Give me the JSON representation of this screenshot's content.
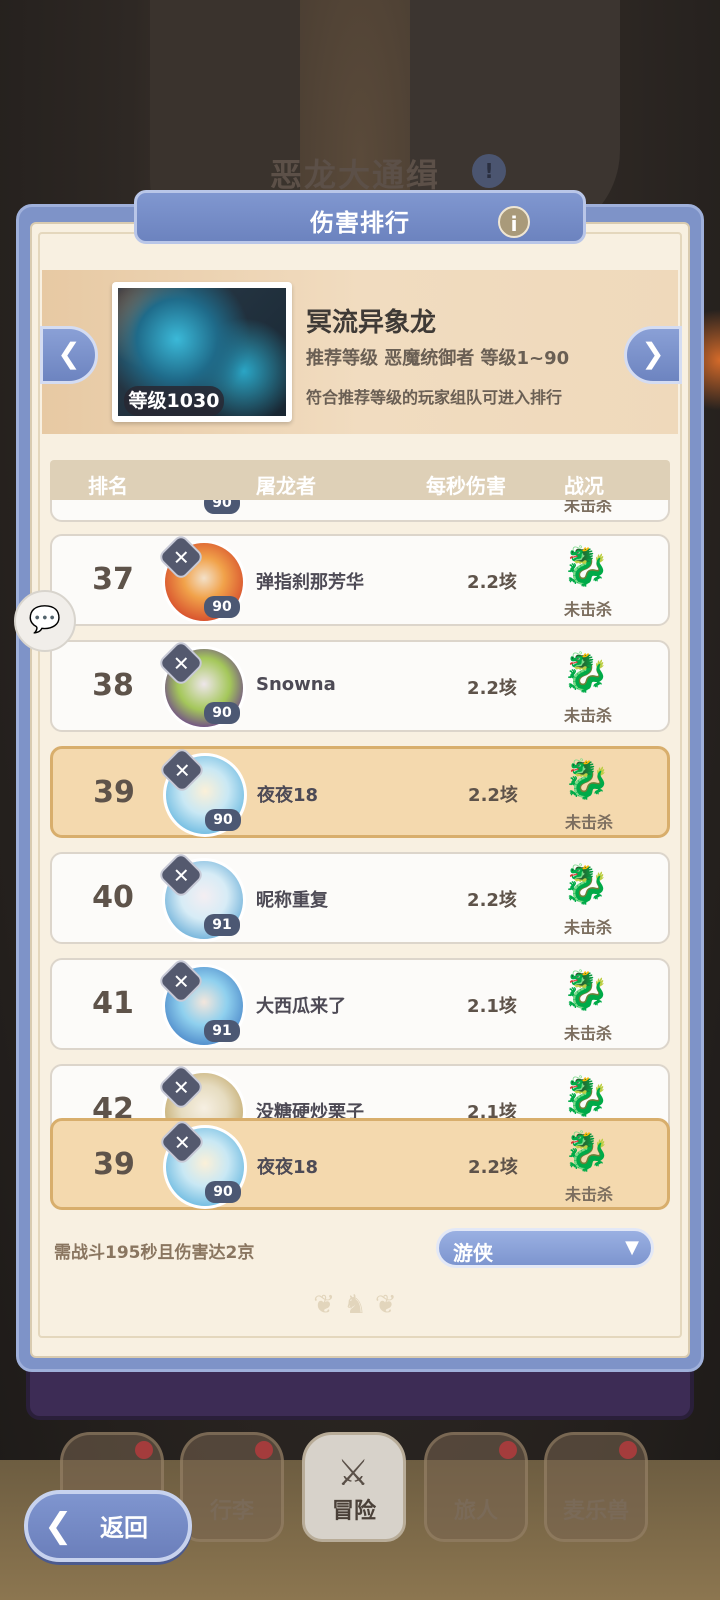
{
  "background": {
    "title": "恶龙大通缉"
  },
  "panel": {
    "title": "伤害排行",
    "info_icon": "info-icon"
  },
  "boss": {
    "level": "等级1030",
    "name": "冥流异象龙",
    "recommended": "推荐等级 恶魔统御者 等级1~90",
    "note": "符合推荐等级的玩家组队可进入排行"
  },
  "table": {
    "headers": [
      "排名",
      "屠龙者",
      "每秒伤害",
      "战况"
    ],
    "rows": [
      {
        "rank": "37",
        "name": "弹指刹那芳华",
        "level": "90",
        "dps": "2.2垓",
        "status": "未击杀",
        "avatar_colors": [
          "#d8522e",
          "#f1a24a"
        ]
      },
      {
        "rank": "38",
        "name": "Snowna",
        "level": "90",
        "dps": "2.2垓",
        "status": "未击杀",
        "avatar_colors": [
          "#6a3f8e",
          "#a4c75a"
        ]
      },
      {
        "rank": "39",
        "name": "夜夜18",
        "level": "90",
        "dps": "2.2垓",
        "status": "未击杀",
        "avatar_colors": [
          "#69b8e0",
          "#c9e8f4"
        ],
        "is_self": true
      },
      {
        "rank": "40",
        "name": "昵称重复",
        "level": "91",
        "dps": "2.2垓",
        "status": "未击杀",
        "avatar_colors": [
          "#6aaed8",
          "#d7ecf6"
        ]
      },
      {
        "rank": "41",
        "name": "大西瓜来了",
        "level": "91",
        "dps": "2.1垓",
        "status": "未击杀",
        "avatar_colors": [
          "#4a86c8",
          "#8fd0ee"
        ]
      },
      {
        "rank": "42",
        "name": "没糖硬炒栗子",
        "level": "",
        "dps": "2.1垓",
        "status": "",
        "avatar_colors": [
          "#c2a86a",
          "#e6dcc0"
        ]
      }
    ],
    "stub": {
      "level": "90",
      "status": "未击杀"
    }
  },
  "self_row": {
    "rank": "39",
    "name": "夜夜18",
    "level": "90",
    "dps": "2.2垓",
    "status": "未击杀"
  },
  "requirement": "需战斗195秒且伤害达2京",
  "class_select": {
    "value": "游侠"
  },
  "nav": {
    "back_label": "返回",
    "tabs": [
      "行李",
      "冒险",
      "旅人",
      "麦乐兽"
    ],
    "active_tab": "冒险"
  },
  "colors": {
    "panel_blue": "#7e93c8",
    "self_highlight": "#f4d9ae",
    "parchment": "#f8f0e1"
  }
}
